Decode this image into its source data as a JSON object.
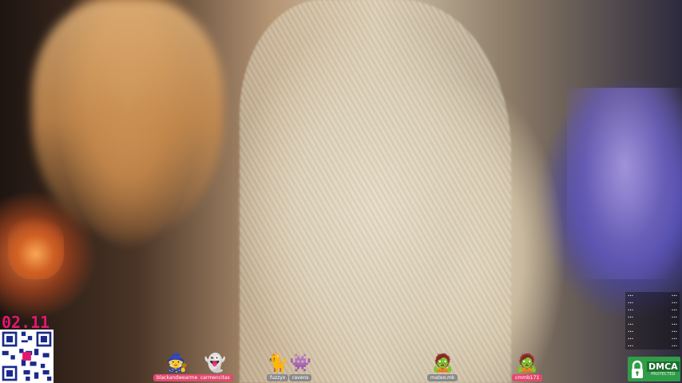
{
  "overlay": {
    "timestamp": "02.11",
    "dmca": {
      "main": "DMCA",
      "sub": "PROTECTED"
    },
    "stickers": [
      {
        "icon": "witch-hat-icon",
        "glyph": "🧙",
        "label": "blackandwearme",
        "grey": false
      },
      {
        "icon": "ghost-icon",
        "glyph": "👻",
        "label": "carmencitas",
        "grey": false
      },
      {
        "icon": "skeleton-cat-icon",
        "glyph": "🐈",
        "label": "fuzzyx",
        "grey": true
      },
      {
        "icon": "ghost-blob-icon",
        "glyph": "👾",
        "label": "ravens",
        "grey": true
      },
      {
        "icon": "zombie-icon",
        "glyph": "🧟",
        "label": "mateo.mk",
        "grey": true
      },
      {
        "icon": "zombies-icon",
        "glyph": "🧟",
        "label": "cmmb171",
        "grey": false
      }
    ]
  }
}
